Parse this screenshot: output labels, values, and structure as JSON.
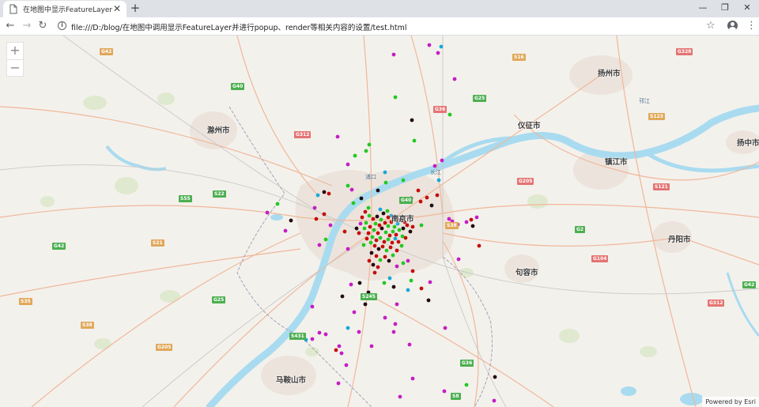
{
  "tab": {
    "title": "在地图中显示FeatureLayer"
  },
  "omnibox": {
    "url": "file:///D:/blog/在地图中调用显示FeatureLayer并进行popup、render等相关内容的设置/test.html"
  },
  "map": {
    "attribution": "Powered by Esri",
    "cities": [
      {
        "label": "扬州市"
      },
      {
        "label": "仪征市"
      },
      {
        "label": "滁州市"
      },
      {
        "label": "镇江市"
      },
      {
        "label": "扬中市"
      },
      {
        "label": "南京市"
      },
      {
        "label": "丹阳市"
      },
      {
        "label": "句容市"
      },
      {
        "label": "马鞍山市"
      },
      {
        "label": "邗江"
      },
      {
        "label": "浦口"
      },
      {
        "label": "长江"
      }
    ],
    "shields": [
      "G42",
      "G40",
      "G25",
      "G36",
      "S16",
      "G328",
      "G312",
      "G205",
      "S123",
      "S55",
      "S121",
      "S38",
      "G2",
      "G40",
      "G42",
      "S22",
      "G104",
      "S21",
      "S35",
      "S431",
      "S38",
      "G25",
      "G42",
      "S245",
      "G312",
      "S8",
      "G205",
      "G36"
    ],
    "point_colors": {
      "green": "#22c922",
      "red": "#c40e0e",
      "magenta": "#c41ec4",
      "cyan": "#18a8d8",
      "black": "#220a10"
    }
  }
}
